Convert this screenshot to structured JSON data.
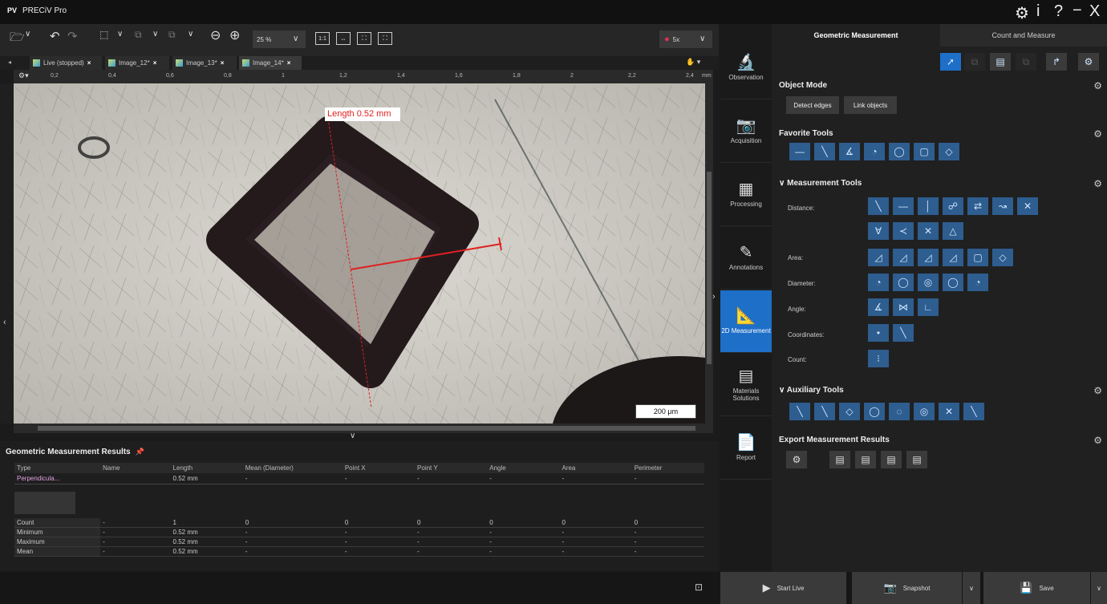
{
  "app": {
    "logo": "PV",
    "title": "PRECiV Pro"
  },
  "window_controls": {
    "settings_icon": "gear-icon",
    "info": "i",
    "help": "?",
    "minimize": "−",
    "close": "X"
  },
  "toolbar": {
    "zoom_value": "25 %",
    "ratio_1_1": "1:1",
    "objective": "5x"
  },
  "tabs": [
    {
      "label": "Live (stopped)"
    },
    {
      "label": "Image_12*"
    },
    {
      "label": "Image_13*"
    },
    {
      "label": "Image_14*"
    }
  ],
  "ruler": {
    "top_ticks": [
      "0,2",
      "0,4",
      "0,6",
      "0,8",
      "1",
      "1,2",
      "1,4",
      "1,6",
      "1,8",
      "2",
      "2,2",
      "2,4"
    ],
    "top_unit": "mm",
    "left_ticks": [
      "0,6",
      "0,8",
      "1",
      "1,2",
      "1,4"
    ],
    "left_unit": "mm"
  },
  "image": {
    "measurement_label": "Length 0.52 mm",
    "scale_bar": "200 μm"
  },
  "results": {
    "title": "Geometric Measurement Results",
    "columns": [
      "Type",
      "Name",
      "Length",
      "Mean (Diameter)",
      "Point X",
      "Point Y",
      "Angle",
      "Area",
      "Perimeter"
    ],
    "rows": [
      {
        "type": "Perpendicula...",
        "name": "",
        "length": "0.52 mm",
        "mean": "-",
        "px": "-",
        "py": "-",
        "angle": "-",
        "area": "-",
        "perimeter": "-"
      }
    ],
    "stats": [
      {
        "label": "Count",
        "name": "-",
        "length": "1",
        "mean": "0",
        "px": "0",
        "py": "0",
        "angle": "0",
        "area": "0",
        "perimeter": "0"
      },
      {
        "label": "Minimum",
        "name": "-",
        "length": "0.52 mm",
        "mean": "-",
        "px": "-",
        "py": "-",
        "angle": "-",
        "area": "-",
        "perimeter": "-"
      },
      {
        "label": "Maximum",
        "name": "-",
        "length": "0.52 mm",
        "mean": "-",
        "px": "-",
        "py": "-",
        "angle": "-",
        "area": "-",
        "perimeter": "-"
      },
      {
        "label": "Mean",
        "name": "-",
        "length": "0.52 mm",
        "mean": "-",
        "px": "-",
        "py": "-",
        "angle": "-",
        "area": "-",
        "perimeter": "-"
      }
    ]
  },
  "nav": [
    {
      "label": "Observation",
      "icon": "microscope-icon"
    },
    {
      "label": "Acquisition",
      "icon": "camera-icon"
    },
    {
      "label": "Processing",
      "icon": "grid-icon"
    },
    {
      "label": "Annotations",
      "icon": "pencil-abc-icon",
      "sub": "ABC"
    },
    {
      "label": "2D Measurement",
      "icon": "ruler-square-icon",
      "active": true
    },
    {
      "label": "Materials Solutions",
      "icon": "materials-icon"
    },
    {
      "label": "Report",
      "icon": "document-icon"
    }
  ],
  "panel": {
    "tabs": [
      "Geometric Measurement",
      "Count and Measure"
    ],
    "object_mode": {
      "title": "Object Mode",
      "buttons": [
        "Detect edges",
        "Link objects"
      ]
    },
    "favorite_tools": {
      "title": "Favorite Tools"
    },
    "measurement_tools": {
      "title": "Measurement Tools",
      "rows": [
        "Distance:",
        "Area:",
        "Diameter:",
        "Angle:",
        "Coordinates:",
        "Count:"
      ]
    },
    "auxiliary_tools": {
      "title": "Auxiliary Tools"
    },
    "export": {
      "title": "Export Measurement Results"
    }
  },
  "bottom": {
    "start_live": "Start Live",
    "snapshot": "Snapshot",
    "save": "Save"
  },
  "colors": {
    "accent": "#1e6fc8",
    "tool_blue": "#2e5d8f",
    "measure_red": "#e02020"
  }
}
